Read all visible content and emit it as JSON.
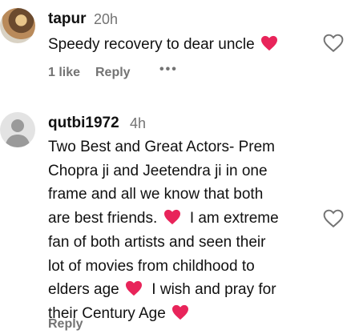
{
  "comments": [
    {
      "username": "tapur",
      "time": "20h",
      "lines": [
        "Speedy recovery to dear uncle"
      ],
      "likes": "1 like",
      "reply": "Reply",
      "more": "•••"
    },
    {
      "username": "qutbi1972",
      "time": "4h",
      "lines": [
        "Two Best and Great Actors- Prem",
        "Chopra ji and Jeetendra ji in one",
        "frame and all we know that both",
        "are best friends.",
        "I am extreme",
        "fan of both artists and seen their",
        "lot of movies from childhood to",
        "elders age",
        "I wish and pray for",
        "their Century Age"
      ],
      "reply": "Reply"
    }
  ],
  "colors": {
    "heart": "#e8245a",
    "muted": "#737373",
    "text": "#111111"
  },
  "icons": {
    "reaction": "red-heart-emoji",
    "like": "heart-outline-icon",
    "more": "more-options-icon"
  }
}
